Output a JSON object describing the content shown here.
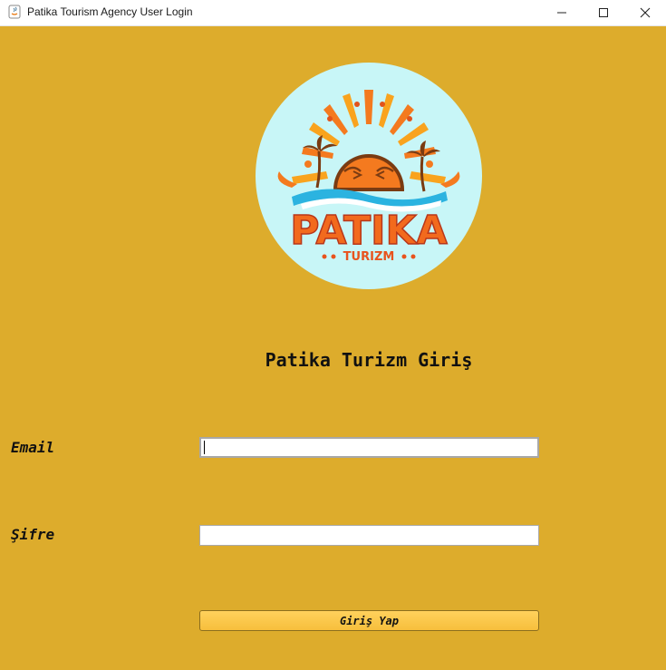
{
  "window": {
    "title": "Patika Tourism Agency User Login"
  },
  "icons": {
    "app": "java-coffee-icon",
    "minimize": "minimize-icon",
    "maximize": "maximize-icon",
    "close": "close-icon"
  },
  "logo": {
    "brand": "PATIKA",
    "subtitle": "TURIZM"
  },
  "form": {
    "title": "Patika Turizm Giriş",
    "email_label": "Email",
    "email_value": "",
    "password_label": "Şifre",
    "password_value": "",
    "submit_label": "Giriş Yap"
  },
  "colors": {
    "background": "#ddac2c",
    "logo_circle": "#c8f6f7",
    "brand_orange": "#f47a1f",
    "button": "#fcc74a"
  }
}
